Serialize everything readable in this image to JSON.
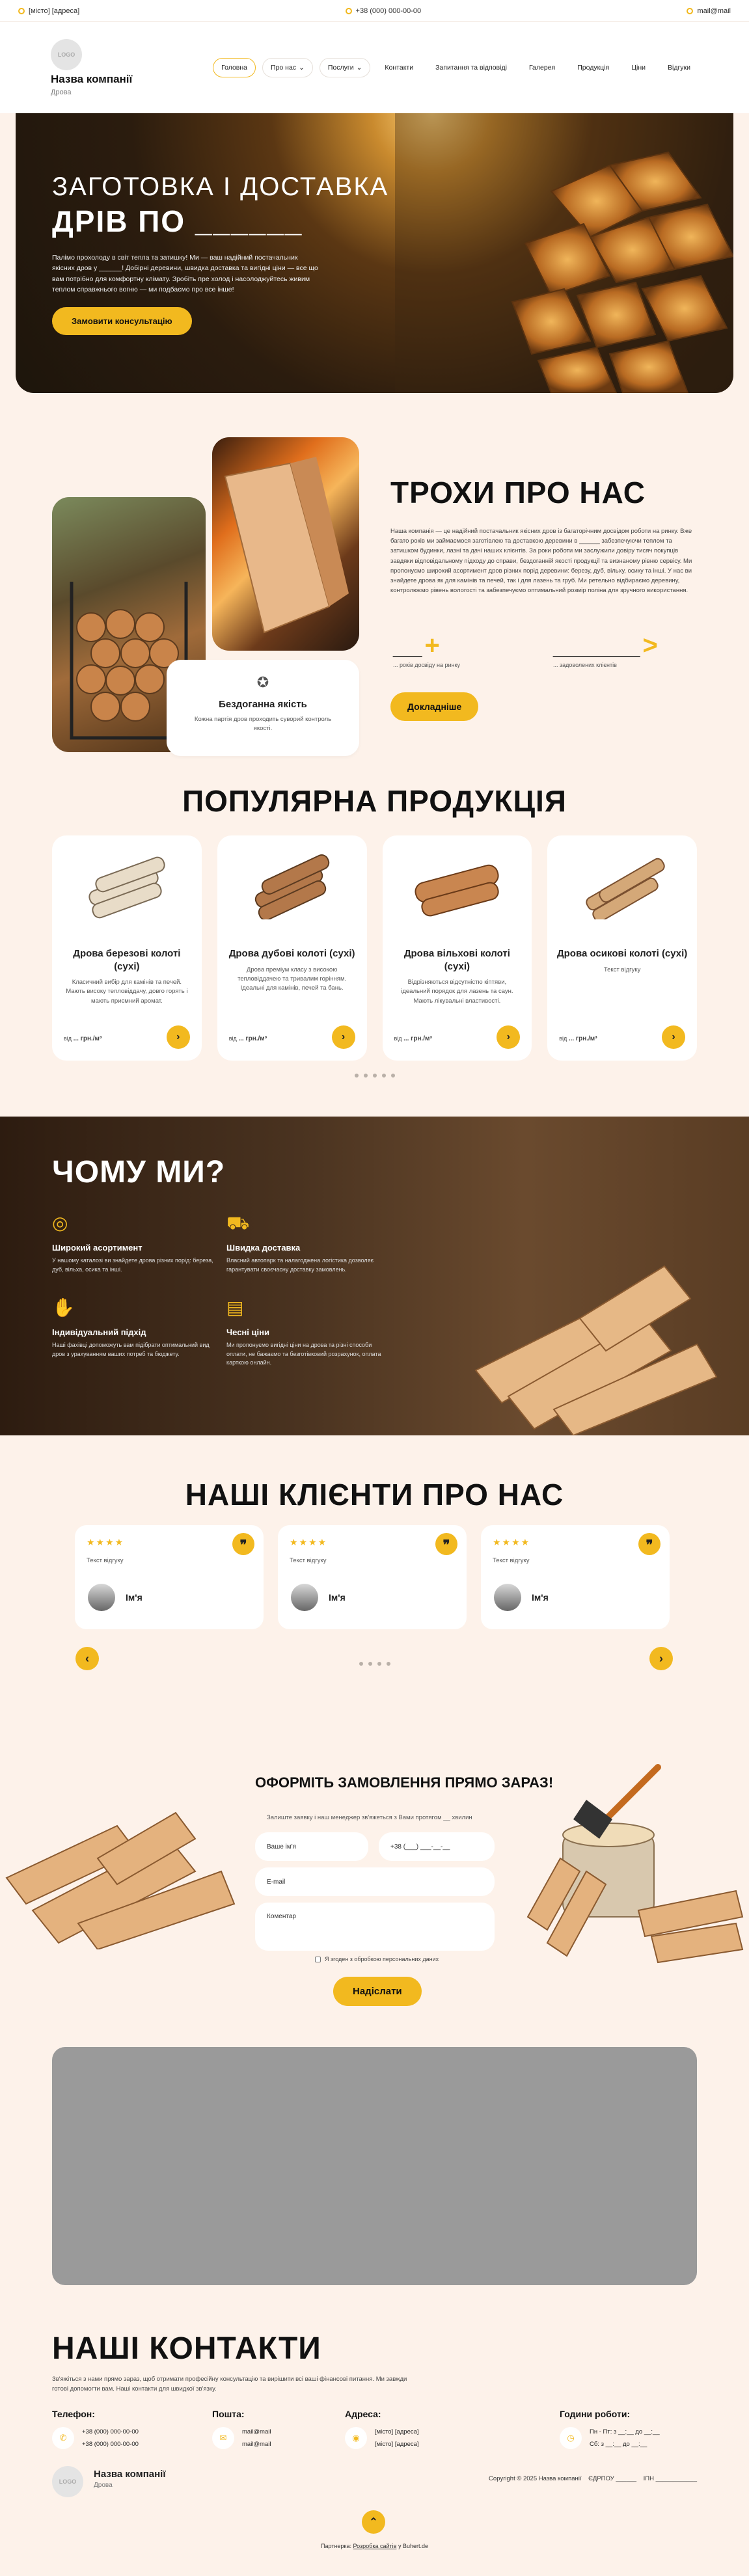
{
  "topbar": {
    "address": "[місто] [адреса]",
    "phone": "+38 (000) 000-00-00",
    "email": "mail@mail"
  },
  "brand": {
    "logo_text": "LOGO",
    "name": "Назва компанії",
    "sub": "Дрова"
  },
  "nav": [
    "Головна",
    "Про нас",
    "Послуги",
    "Контакти",
    "Запитання та відповіді",
    "Галерея",
    "Продукція",
    "Ціни",
    "Відгуки"
  ],
  "hero": {
    "line1": "ЗАГОТОВКА І ДОСТАВКА",
    "line2": "ДРІВ ПО ______",
    "text": "Палімо прохолоду в світ тепла та затишку! Ми — ваш надійний постачальник якісних дров у ______! Добірні деревини, швидка доставка та вигідні ціни — все що вам потрібно для комфортну клімату. Зробіть пре холод і насолоджуйтесь живим теплом справжнього вогню — ми подбаємо про все інше!",
    "cta": "Замовити консультацію"
  },
  "about": {
    "title": "ТРОХИ ПРО НАС",
    "text": "Наша компанія — це надійний постачальник якісних дров із багаторічним досвідом роботи на ринку. Вже багато років ми займаємося заготівлею та доставкою деревини в ______ забезпечуючи теплом та затишком будинки, лазні та дачі наших клієнтів. За роки роботи ми заслужили довіру тисяч покупців завдяки відповідальному підходу до справи, бездоганній якості продукції та визнаному рівню сервісу. Ми пропонуємо широкий асортимент дров різних порід деревини: березу, дуб, вільху, осику та інші. У нас ви знайдете дрова як для камінів та печей, так і для лазень та груб. Ми ретельно відбираємо деревину, контролюємо рівень вологості та забезпечуємо оптимальний розмір поліна для зручного використання.",
    "card_title": "Бездоганна якість",
    "card_desc": "Кожна партія дров проходить суворий контроль якості.",
    "stat1_label": "... років досвіду на ринку",
    "stat2_label": "... задоволених клієнтів",
    "cta": "Докладніше"
  },
  "products": {
    "title": "ПОПУЛЯРНА ПРОДУКЦІЯ",
    "items": [
      {
        "name": "Дрова березові колоті (сухі)",
        "desc": "Класичний вибір для камінів та печей. Мають високу тепловіддачу, довго горять і мають приємний аромат.",
        "price_prefix": "від",
        "price": "... грн./м³"
      },
      {
        "name": "Дрова дубові колоті (сухі)",
        "desc": "Дрова преміум класу з високою тепловіддачею та тривалим горінням. Ідеальні для камінів, печей та бань.",
        "price_prefix": "від",
        "price": "... грн./м³"
      },
      {
        "name": "Дрова вільхові колоті (сухі)",
        "desc": "Відрізняються відсутністю кіптяви, ідеальний порядок для лазень та саун. Мають лікувальні властивості.",
        "price_prefix": "від",
        "price": "... грн./м³"
      },
      {
        "name": "Дрова осикові колоті (сухі)",
        "desc": "Текст відгуку",
        "price_prefix": "від",
        "price": "... грн./м³"
      }
    ]
  },
  "why": {
    "title": "ЧОМУ МИ?",
    "items": [
      {
        "title": "Широкий асортимент",
        "desc": "У нашому каталозі ви знайдете дрова різних порід: береза, дуб, вільха, осика та інші."
      },
      {
        "title": "Швидка доставка",
        "desc": "Власний автопарк та налагоджена логістика дозволяє гарантувати своєчасну доставку замовлень."
      },
      {
        "title": "Індивідуальний підхід",
        "desc": "Наші фахівці допоможуть вам підібрати оптимальний вид дров з урахуванням ваших потреб та бюджету."
      },
      {
        "title": "Чесні ціни",
        "desc": "Ми пропонуємо вигідні ціни на дрова та різні способи оплати, не бажаємо та безготівковий розрахунок, оплата карткою онлайн."
      }
    ]
  },
  "reviews": {
    "title": "НАШІ КЛІЄНТИ ПРО НАС",
    "items": [
      {
        "text": "Текст відгуку",
        "name": "Ім'я",
        "stars": "★★★★"
      },
      {
        "text": "Текст відгуку",
        "name": "Ім'я",
        "stars": "★★★★"
      },
      {
        "text": "Текст відгуку",
        "name": "Ім'я",
        "stars": "★★★★"
      }
    ]
  },
  "order": {
    "title": "ОФОРМІТЬ ЗАМОВЛЕННЯ ПРЯМО ЗАРАЗ!",
    "subtitle": "Залиште заявку і наш менеджер зв'яжеться з Вами протягом __ хвилин",
    "name_placeholder": "Ваше ім'я",
    "phone_placeholder": "+38 (___) ___-__-__",
    "email_placeholder": "E-mail",
    "comment_placeholder": "Коментар",
    "consent": "Я згоден з обробкою персональних даних",
    "submit": "Надіслати"
  },
  "contacts": {
    "title": "НАШІ КОНТАКТИ",
    "intro": "Зв'яжіться з нами прямо зараз, щоб отримати професійну консультацію та вирішити всі ваші фінансові питання. Ми завжди готові допомогти вам. Наші контакти для швидкої зв'язку.",
    "phone_h": "Телефон:",
    "phones": [
      "+38 (000) 000-00-00",
      "+38 (000) 000-00-00"
    ],
    "mail_h": "Пошта:",
    "mails": [
      "mail@mail",
      "mail@mail"
    ],
    "addr_h": "Адреса:",
    "addrs": [
      "[місто] [адреса]",
      "[місто] [адреса]"
    ],
    "hours_h": "Години роботи:",
    "hours": [
      "Пн - Пт: з __:__ до __:__",
      "Сб: з __:__ до __:__"
    ]
  },
  "footer": {
    "copyright": "Copyright © 2025 Назва компанії",
    "edrpou": "ЄДРПОУ ______",
    "ipn": "ІПН ____________",
    "dev_prefix": "Партнерка:",
    "dev_link": "Розробка сайтів",
    "dev_suffix": "у Buhert.de"
  },
  "colors": {
    "accent": "#f2b91f",
    "bg": "#fdf2ea"
  }
}
